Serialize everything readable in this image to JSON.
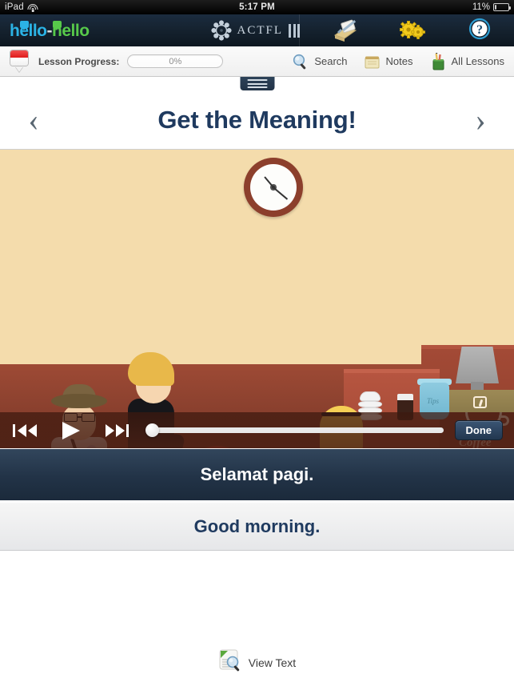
{
  "status_bar": {
    "device": "iPad",
    "wifi_icon": "wifi-icon",
    "time": "5:17 PM",
    "battery_percent": "11%",
    "battery_icon": "battery-icon"
  },
  "brand_bar": {
    "logo_part_a": "hello",
    "logo_dash": "-",
    "logo_part_b": "hello",
    "partner_name": "ACTFL",
    "partner_icon": "actfl-rosette-icon",
    "icons": [
      {
        "name": "notebook-icon",
        "label": "Notebook"
      },
      {
        "name": "gears-icon",
        "label": "Settings"
      },
      {
        "name": "help-icon",
        "label": "Help"
      }
    ]
  },
  "toolbar": {
    "flag_icon": "indonesia-flag-icon",
    "progress_label": "Lesson Progress:",
    "progress_value": "0%",
    "progress_percent": 0,
    "actions": [
      {
        "name": "search",
        "label": "Search",
        "icon": "search-icon"
      },
      {
        "name": "notes",
        "label": "Notes",
        "icon": "notes-icon"
      },
      {
        "name": "all-lessons",
        "label": "All Lessons",
        "icon": "all-lessons-icon"
      }
    ]
  },
  "title_bar": {
    "tab_handle_icon": "hamburger-icon",
    "prev_icon": "‹",
    "title": "Get the Meaning!",
    "next_icon": "›"
  },
  "video": {
    "scene_description": "Cartoon cafe scene",
    "counter_brand": "Coffee",
    "tip_jar_label": "Tips",
    "controls": {
      "rewind_icon": "rewind-to-start-icon",
      "play_icon": "play-icon",
      "forward_icon": "skip-forward-icon",
      "scrubber_position": 0,
      "done_label": "Done"
    }
  },
  "subtitles": {
    "target_language": "Selamat pagi.",
    "translation": "Good morning."
  },
  "footer": {
    "view_text_label": "View Text",
    "view_text_icon": "view-text-icon"
  },
  "colors": {
    "brand_navy": "#1b2c3f",
    "title_navy": "#1f3a5f",
    "logo_blue": "#2bb3e5",
    "logo_green": "#57c94a",
    "flag_red": "#e01b1b"
  }
}
